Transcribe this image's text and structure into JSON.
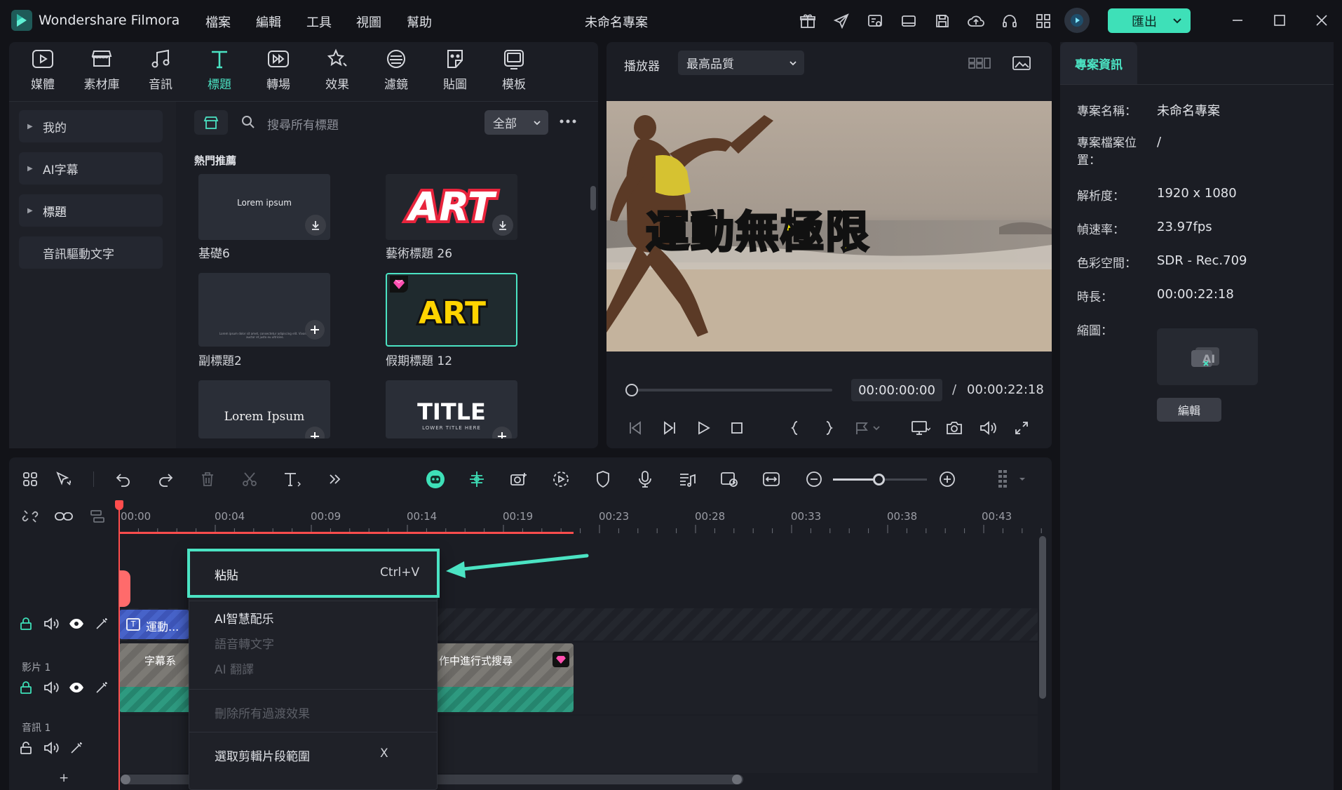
{
  "app": {
    "name": "Wondershare Filmora",
    "project_title": "未命名專案"
  },
  "menu": [
    "檔案",
    "編輯",
    "工具",
    "視圖",
    "幫助"
  ],
  "export_label": "匯出",
  "tools": [
    {
      "label": "媒體",
      "icon": "media-icon"
    },
    {
      "label": "素材庫",
      "icon": "stock-icon"
    },
    {
      "label": "音訊",
      "icon": "music-note-icon"
    },
    {
      "label": "標題",
      "icon": "title-t-icon"
    },
    {
      "label": "轉場",
      "icon": "transition-icon"
    },
    {
      "label": "效果",
      "icon": "effects-icon"
    },
    {
      "label": "濾鏡",
      "icon": "filter-icon"
    },
    {
      "label": "貼圖",
      "icon": "sticker-icon"
    },
    {
      "label": "模板",
      "icon": "template-icon"
    }
  ],
  "active_tool": "標題",
  "sidebar": {
    "items": [
      "我的",
      "AI字幕",
      "標題",
      "音訊驅動文字"
    ]
  },
  "search": {
    "placeholder": "搜尋所有標題",
    "filter": "全部"
  },
  "section_title": "熱門推薦",
  "title_cards": [
    {
      "label": "基礎6",
      "preview": "Lorem ipsum"
    },
    {
      "label": "藝術標題 26",
      "preview": "ART"
    },
    {
      "label": "副標題2",
      "preview": "Lorem ipsum dolor sit amet, consectetur adipiscing elit. Vivamus auctor et justo eu ultricies."
    },
    {
      "label": "假期標題 12",
      "preview": "ART"
    },
    {
      "label": "",
      "preview": "Lorem Ipsum"
    },
    {
      "label": "",
      "preview": "TITLE",
      "subpreview": "LOWER TITLE HERE"
    }
  ],
  "player": {
    "label": "播放器",
    "quality": "最高品質",
    "overlay_text": "運動無極限",
    "current_time": "00:00:00:00",
    "separator": "/",
    "total_time": "00:00:22:18",
    "progress": 0
  },
  "project_info": {
    "tab": "專案資訊",
    "fields": [
      {
        "key": "專案名稱：",
        "value": "未命名專案"
      },
      {
        "key": "專案檔案位置：",
        "value": "/"
      },
      {
        "key": "解析度：",
        "value": "1920 x 1080"
      },
      {
        "key": "幀速率：",
        "value": "23.97fps"
      },
      {
        "key": "色彩空間：",
        "value": "SDR - Rec.709"
      },
      {
        "key": "時長：",
        "value": "00:00:22:18"
      },
      {
        "key": "縮圖：",
        "value": ""
      }
    ],
    "edit_button": "編輯"
  },
  "timeline": {
    "ticks": [
      "00:00",
      "00:04",
      "00:09",
      "00:14",
      "00:19",
      "00:23",
      "00:28",
      "00:33",
      "00:38",
      "00:43"
    ],
    "tracks": {
      "video": "影片 1",
      "audio": "音訊 1"
    },
    "clips": {
      "title_clip": "運動...",
      "video_clip_a": "字幕系",
      "video_clip_b": "作中進行式搜尋"
    },
    "add_track": "+"
  },
  "context_menu": {
    "items": [
      {
        "label": "粘貼",
        "shortcut": "Ctrl+V",
        "enabled": true,
        "highlighted": true
      },
      {
        "label": "AI智慧配乐",
        "shortcut": "",
        "enabled": true
      },
      {
        "label": "語音轉文字",
        "shortcut": "",
        "enabled": false
      },
      {
        "label": "AI 翻譯",
        "shortcut": "",
        "enabled": false
      },
      {
        "label": "刪除所有過渡效果",
        "shortcut": "",
        "enabled": false
      },
      {
        "label": "選取剪輯片段範圍",
        "shortcut": "X",
        "enabled": true
      }
    ]
  },
  "colors": {
    "accent": "#4be3c3",
    "playhead": "#ff4d4d",
    "background": "#121318",
    "panel": "#1b1d24"
  }
}
